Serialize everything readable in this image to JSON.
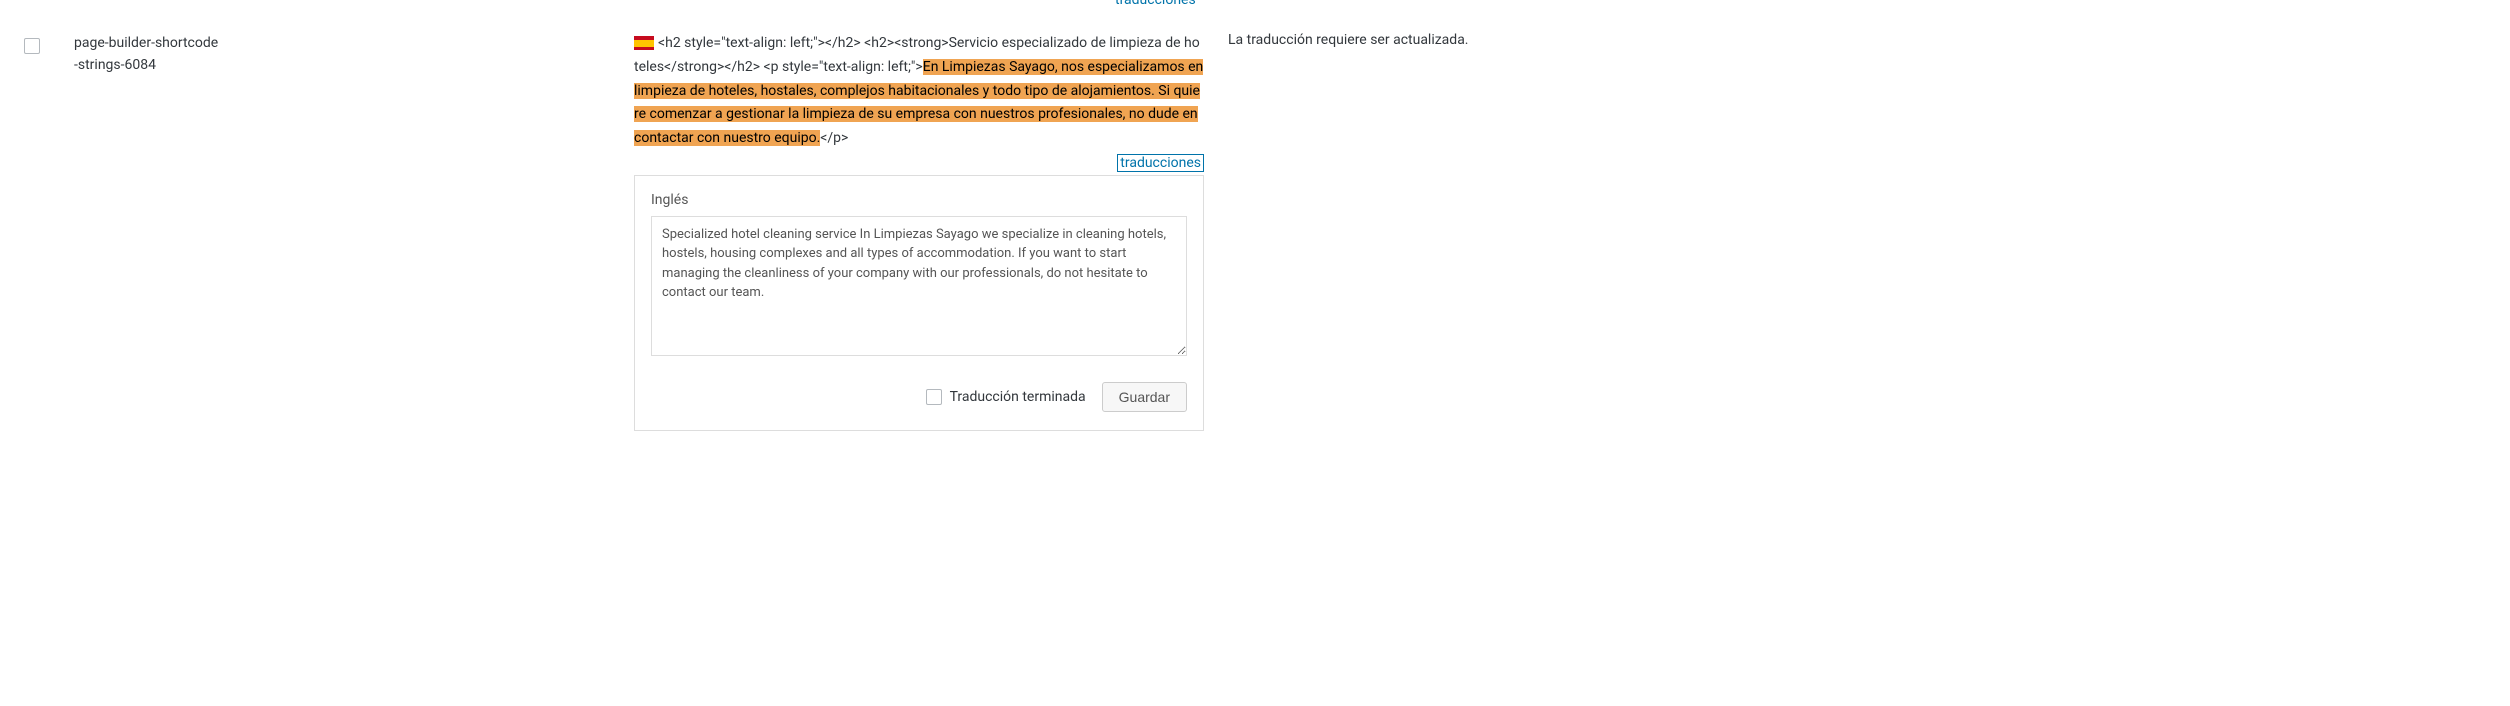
{
  "top_link": "traducciones",
  "row": {
    "name_line1": "page-builder-shortcode",
    "name_line2": "-strings-6084",
    "source": {
      "pre": "<h2 style=\"text-align: left;\"></h2> <h2><strong>Servicio especializado de limpieza de hoteles</strong></h2> <p style=\"text-align: left;\">",
      "highlight": "En Limpiezas Sayago, nos especializamos en limpieza de hoteles, hostales, complejos habitacionales y todo tipo de alojamientos. Si quiere comenzar a gestionar la limpieza de su empresa con nuestros profesionales, no dude en contactar con nuestro equipo.",
      "post": "</p>"
    },
    "traducciones_label": "traducciones",
    "translation_lang": "Inglés",
    "translation_text": "Specialized hotel cleaning service In Limpiezas Sayago we specialize in cleaning hotels, hostels, housing complexes and all types of accommodation. If you want to start managing the cleanliness of your company with our professionals, do not hesitate to contact our team.",
    "complete_label": "Traducción terminada",
    "save_label": "Guardar",
    "status": "La traducción requiere ser actualizada."
  }
}
